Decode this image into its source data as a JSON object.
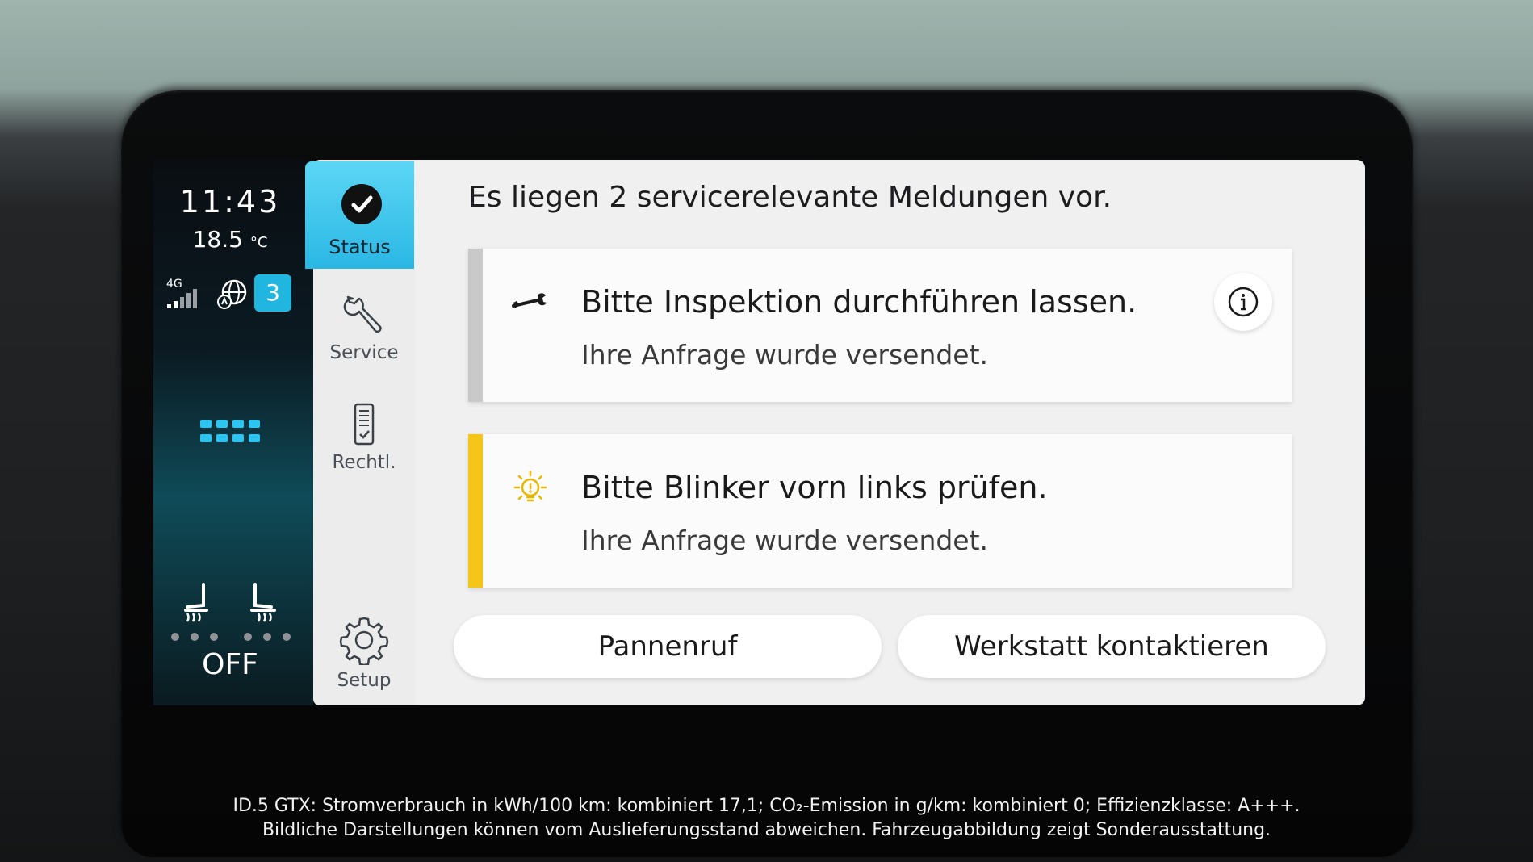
{
  "status_bar": {
    "time": "11:43",
    "temperature": "18.5",
    "temperature_unit": "°C",
    "network_label": "4G",
    "notification_count": "3"
  },
  "climate": {
    "seat_heating_state": "OFF"
  },
  "nav": {
    "items": [
      {
        "label": "Status",
        "icon": "check-circle-icon",
        "active": true
      },
      {
        "label": "Service",
        "icon": "wrench-icon",
        "active": false
      },
      {
        "label": "Rechtl.",
        "icon": "document-icon",
        "active": false
      },
      {
        "label": "Setup",
        "icon": "gear-icon",
        "active": false
      }
    ]
  },
  "main": {
    "heading": "Es liegen 2 servicerelevante Meldungen vor.",
    "messages": [
      {
        "title": "Bitte Inspektion durchführen lassen.",
        "subtitle": "Ihre Anfrage wurde versendet.",
        "icon": "wrench-icon",
        "accent": "#c9c9c9"
      },
      {
        "title": "Bitte Blinker vorn links prüfen.",
        "subtitle": "Ihre Anfrage wurde versendet.",
        "icon": "bulb-warning-icon",
        "accent": "#f5c518"
      }
    ],
    "actions": {
      "breakdown": "Pannenruf",
      "contact_workshop": "Werkstatt kontaktieren"
    }
  },
  "disclaimer": {
    "line1": "ID.5 GTX: Stromverbrauch in kWh/100 km: kombiniert 17,1; CO₂-Emission in g/km: kombiniert 0; Effizienzklasse: A+++.",
    "line2": "Bildliche Darstellungen können vom Auslieferungsstand abweichen. Fahrzeugabbildung zeigt Sonderausstattung."
  },
  "colors": {
    "accent_blue": "#2ab7e4",
    "warning_yellow": "#f5c518"
  }
}
